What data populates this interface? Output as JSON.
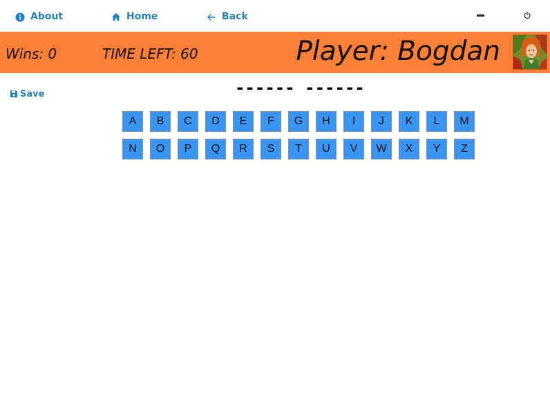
{
  "nav": {
    "about_label": "About",
    "home_label": "Home",
    "back_label": "Back",
    "accent_color": "#2a7fb8",
    "icons": [
      "info-icon",
      "home-icon",
      "arrow-left-icon",
      "minimize-icon",
      "power-icon"
    ]
  },
  "status": {
    "wins": "Wins: 0",
    "time_left": "TIME LEFT: 60",
    "player": "Player: Bogdan",
    "bar_color": "#fe7f36"
  },
  "save": {
    "label": "Save",
    "icon": "floppy-disk-icon"
  },
  "puzzle": {
    "masked_word": "------ ------"
  },
  "keyboard": {
    "key_color": "#3a96f5",
    "rows": [
      [
        "A",
        "B",
        "C",
        "D",
        "E",
        "F",
        "G",
        "H",
        "I",
        "J",
        "K",
        "L",
        "M"
      ],
      [
        "N",
        "O",
        "P",
        "Q",
        "R",
        "S",
        "T",
        "U",
        "V",
        "W",
        "X",
        "Y",
        "Z"
      ]
    ]
  }
}
